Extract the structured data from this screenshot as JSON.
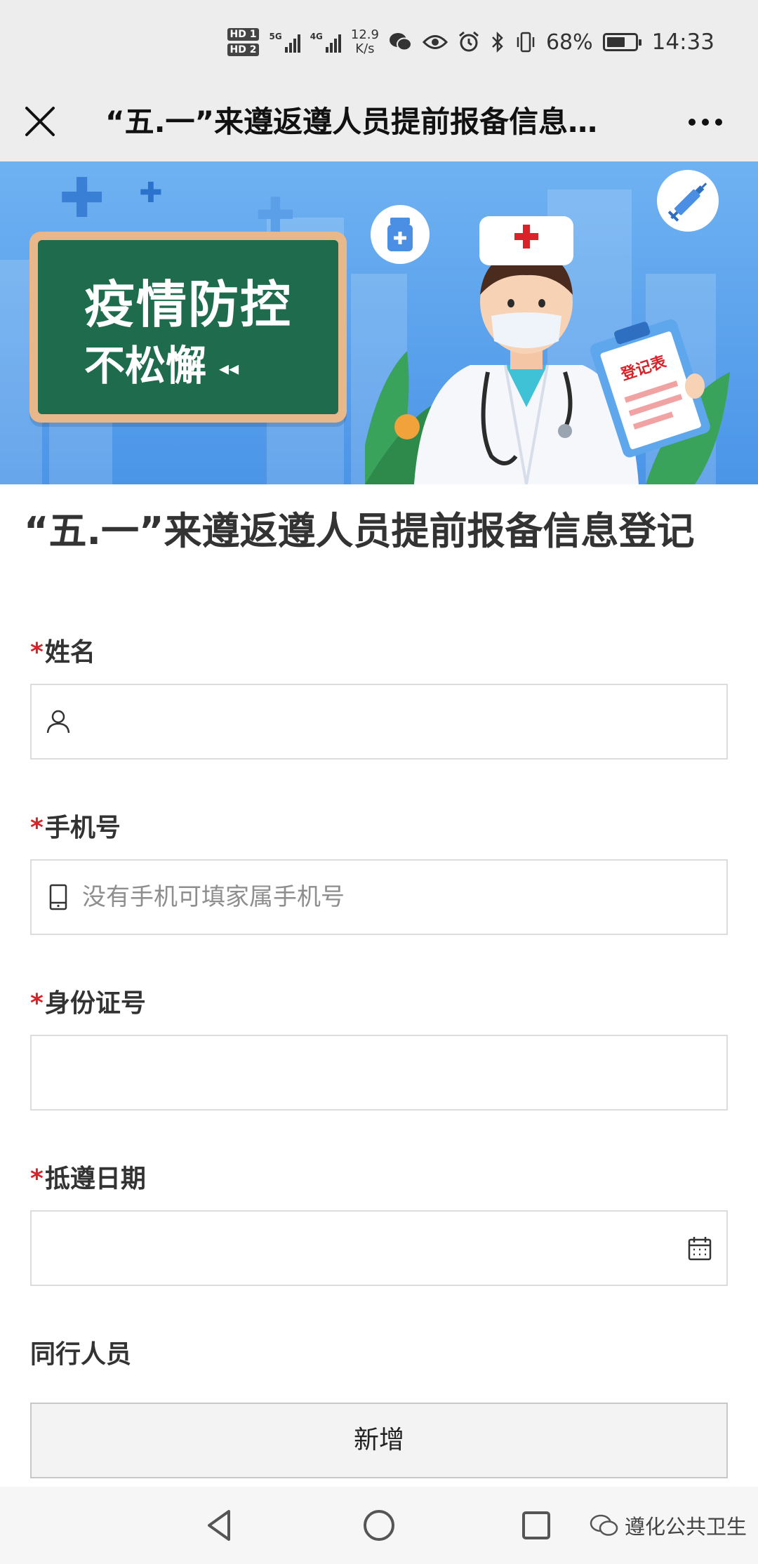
{
  "status_bar": {
    "hd1": "HD 1",
    "hd2": "HD 2",
    "net1": "5G",
    "net2": "4G",
    "speed_value": "12.9",
    "speed_unit": "K/s",
    "battery_percent": "68%",
    "battery_level": 0.68,
    "time": "14:33",
    "icons": [
      "wechat-icon",
      "eye-icon",
      "alarm-icon",
      "bluetooth-icon",
      "vibrate-icon"
    ]
  },
  "title_bar": {
    "title": "“五.一”来遵返遵人员提前报备信息…"
  },
  "banner": {
    "line1": "疫情防控",
    "line2": "不松懈",
    "clipboard_text": "登记表"
  },
  "form": {
    "title": "“五.一”来遵返遵人员提前报备信息登记",
    "required_mark": "*",
    "name": {
      "label": "姓名",
      "value": ""
    },
    "phone": {
      "label": "手机号",
      "placeholder": "没有手机可填家属手机号"
    },
    "id_number": {
      "label": "身份证号",
      "value": ""
    },
    "arrival_date": {
      "label": "抵遵日期",
      "value": ""
    },
    "companions": {
      "label": "同行人员",
      "add_button": "新增"
    }
  },
  "nav_bar": {
    "brand": "遵化公共卫生"
  },
  "colors": {
    "required": "#d8232a",
    "bar_bg": "#ededed",
    "board_green": "#1f6b4d",
    "banner_blue": "#5aa2ee"
  }
}
